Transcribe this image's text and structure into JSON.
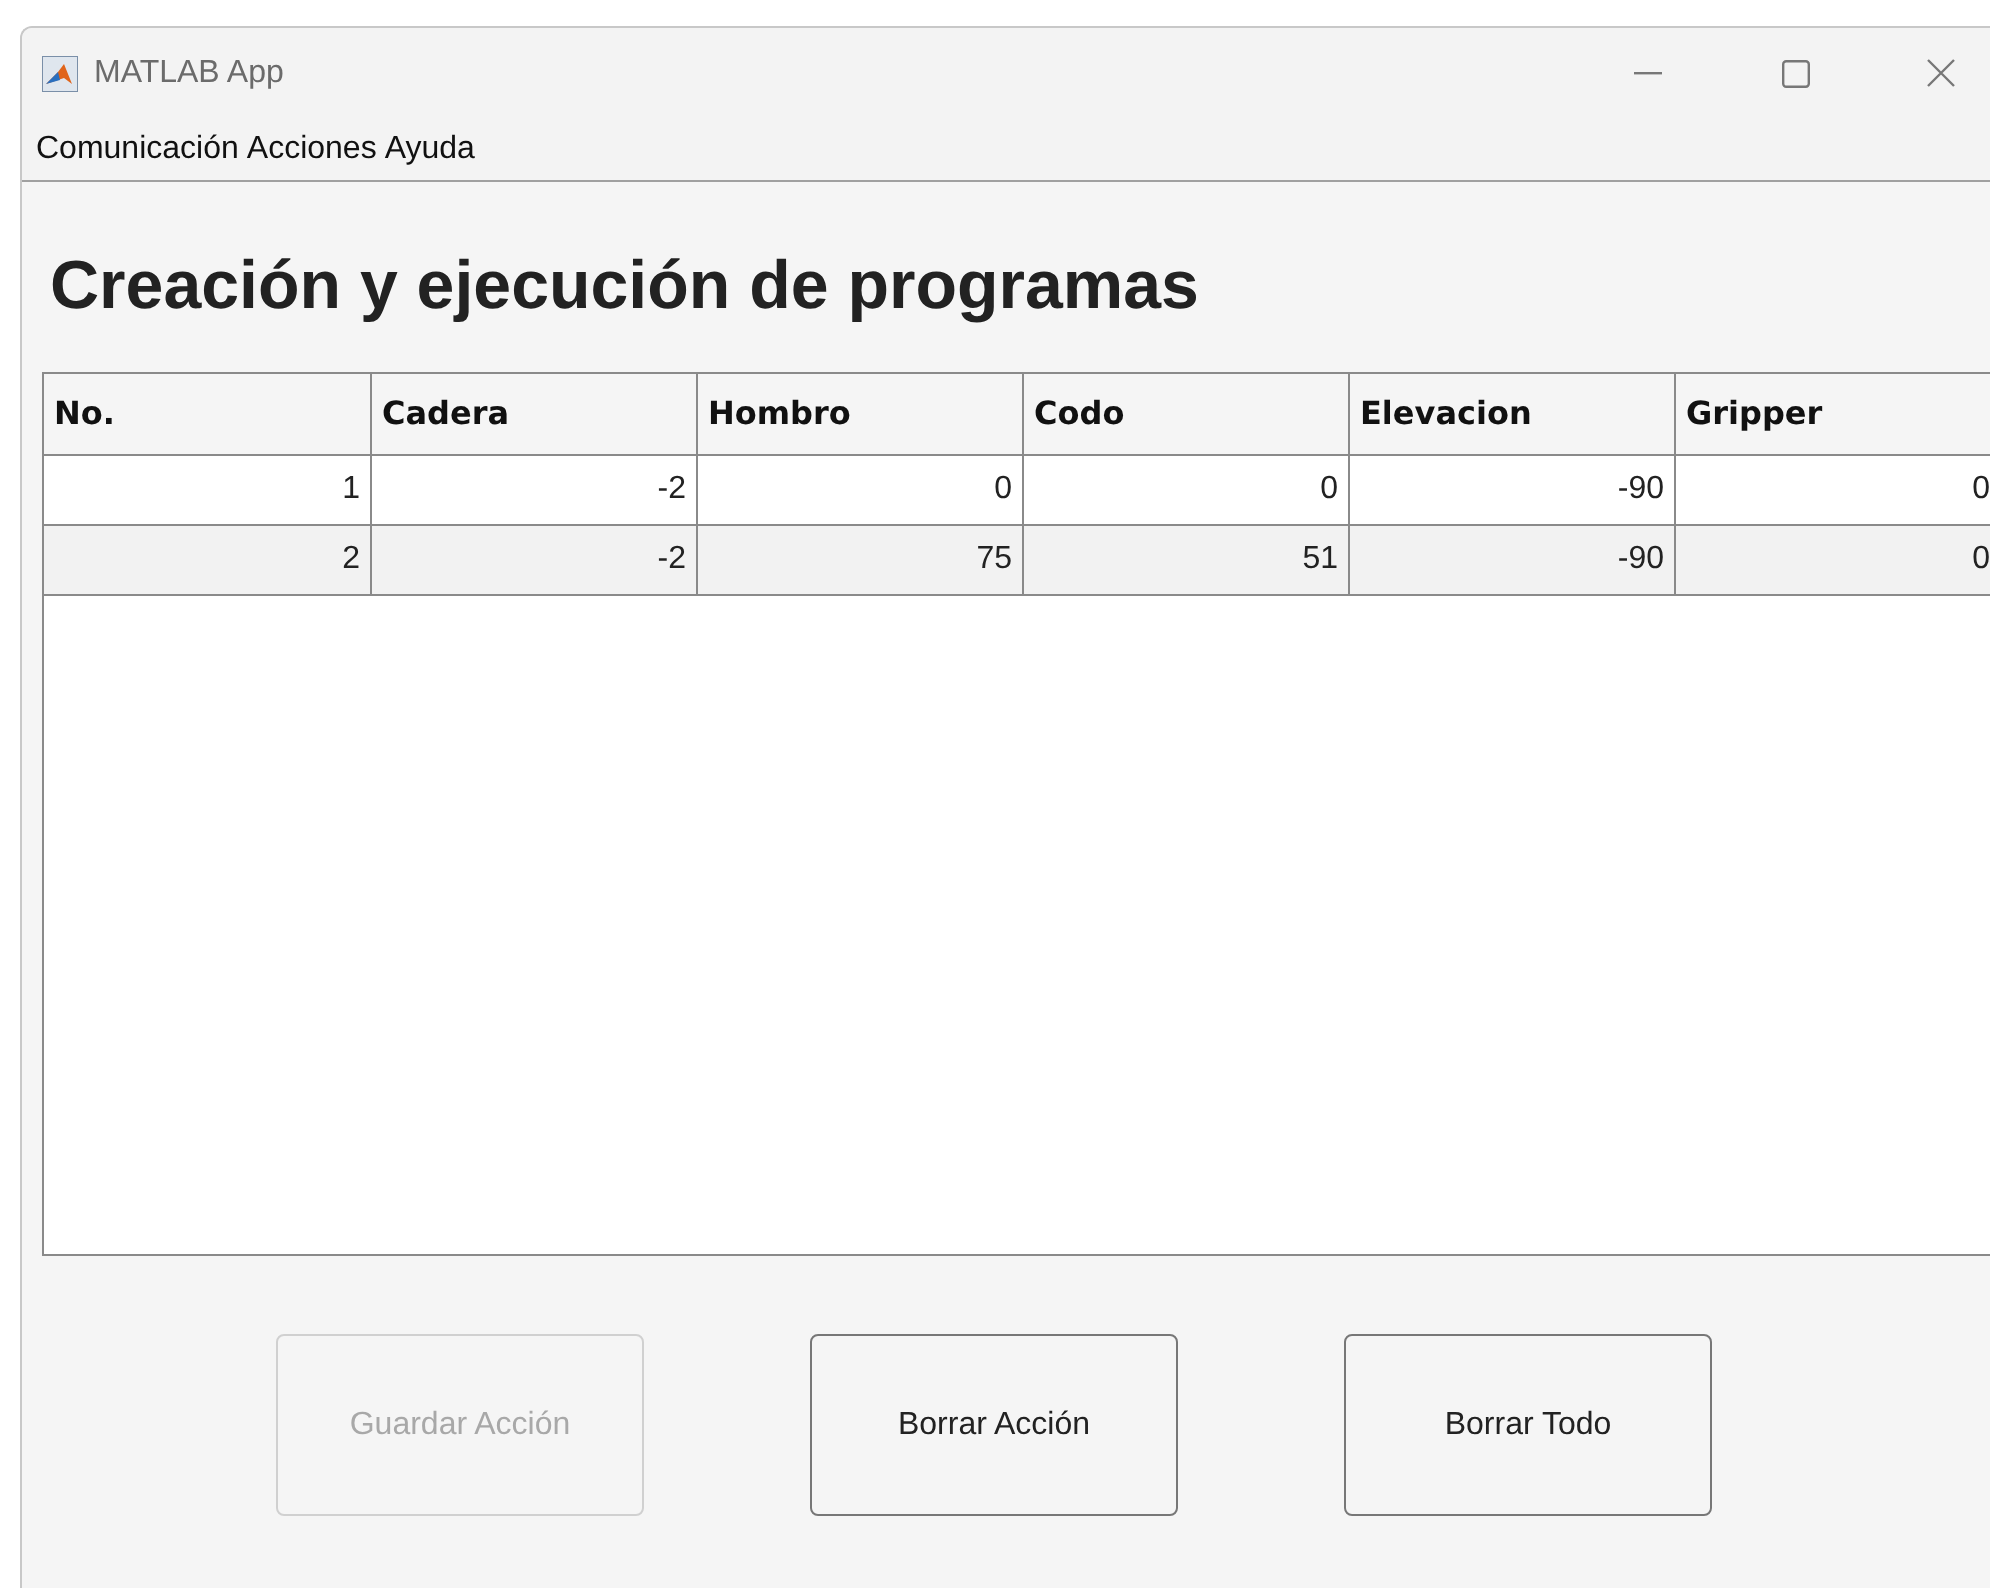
{
  "window": {
    "title": "MATLAB App"
  },
  "menu": [
    "Comunicación",
    "Acciones",
    "Ayuda"
  ],
  "heading": "Creación y ejecución de programas",
  "table": {
    "columns": [
      "No.",
      "Cadera",
      "Hombro",
      "Codo",
      "Elevacion",
      "Gripper"
    ],
    "rows": [
      [
        "1",
        "-2",
        "0",
        "0",
        "-90",
        "0"
      ],
      [
        "2",
        "-2",
        "75",
        "51",
        "-90",
        "0"
      ]
    ]
  },
  "buttons": [
    {
      "label": "Guardar Acción",
      "disabled": true
    },
    {
      "label": "Borrar Acción",
      "disabled": false
    },
    {
      "label": "Borrar Todo",
      "disabled": false
    }
  ]
}
